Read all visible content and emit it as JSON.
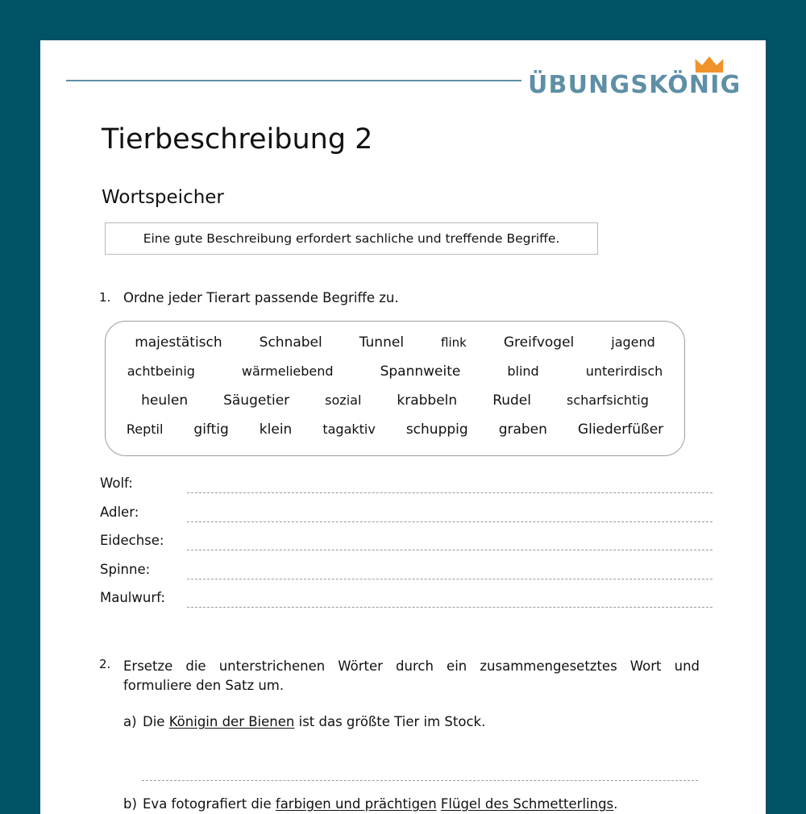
{
  "theme": {
    "background_color": "#005266",
    "page_color": "#ffffff",
    "logo_color": "#5e8fa6",
    "crown_color": "#f0932b",
    "rule_color": "#5e8fa6",
    "line_color": "#9b9b9b"
  },
  "header": {
    "logo_text": "ÜBUNGSKÖNIG",
    "crown_icon": "crown-icon",
    "rule": "header-rule"
  },
  "worksheet": {
    "title": "Tierbeschreibung 2",
    "subtitle": "Wortspeicher",
    "info_box": "Eine gute Beschreibung erfordert sachliche und treffende Begriffe."
  },
  "task1": {
    "number": "1.",
    "instruction": "Ordne jeder Tierart passende Begriffe zu.",
    "wordbank_rows": [
      [
        {
          "text": "majestätisch",
          "size": 17
        },
        {
          "text": "Schnabel",
          "size": 17
        },
        {
          "text": "Tunnel",
          "size": 17
        },
        {
          "text": "flink",
          "size": 15
        },
        {
          "text": "Greifvogel",
          "size": 17
        },
        {
          "text": "jagend",
          "size": 16
        }
      ],
      [
        {
          "text": "achtbeinig",
          "size": 16
        },
        {
          "text": "wärmeliebend",
          "size": 16
        },
        {
          "text": "Spannweite",
          "size": 17
        },
        {
          "text": "blind",
          "size": 16
        },
        {
          "text": "unterirdisch",
          "size": 16
        }
      ],
      [
        {
          "text": "heulen",
          "size": 17
        },
        {
          "text": "Säugetier",
          "size": 17
        },
        {
          "text": "sozial",
          "size": 16
        },
        {
          "text": "krabbeln",
          "size": 17
        },
        {
          "text": "Rudel",
          "size": 17
        },
        {
          "text": "scharfsichtig",
          "size": 16
        }
      ],
      [
        {
          "text": "Reptil",
          "size": 16
        },
        {
          "text": "giftig",
          "size": 17
        },
        {
          "text": "klein",
          "size": 17
        },
        {
          "text": "tagaktiv",
          "size": 16
        },
        {
          "text": "schuppig",
          "size": 17
        },
        {
          "text": "graben",
          "size": 17
        },
        {
          "text": "Gliederfüßer",
          "size": 17
        }
      ]
    ],
    "answer_rows": [
      {
        "label": "Wolf:",
        "value": ""
      },
      {
        "label": "Adler:",
        "value": ""
      },
      {
        "label": "Eidechse:",
        "value": ""
      },
      {
        "label": "Spinne:",
        "value": ""
      },
      {
        "label": "Maulwurf:",
        "value": ""
      }
    ]
  },
  "task2": {
    "number": "2.",
    "instruction": "Ersetze die unterstrichenen Wörter durch ein zusammengesetztes Wort und formuliere den Satz um.",
    "items": [
      {
        "marker": "a)",
        "parts": [
          {
            "text": "Die ",
            "underline": false
          },
          {
            "text": "Königin der Bienen",
            "underline": true
          },
          {
            "text": " ist das größte Tier im Stock.",
            "underline": false
          }
        ]
      },
      {
        "marker": "b)",
        "parts": [
          {
            "text": "Eva fotografiert die ",
            "underline": false
          },
          {
            "text": "farbigen und prächtigen",
            "underline": true
          },
          {
            "text": " ",
            "underline": false
          },
          {
            "text": "Flügel des Schmetterlings",
            "underline": true
          },
          {
            "text": ".",
            "underline": false
          }
        ]
      }
    ]
  }
}
